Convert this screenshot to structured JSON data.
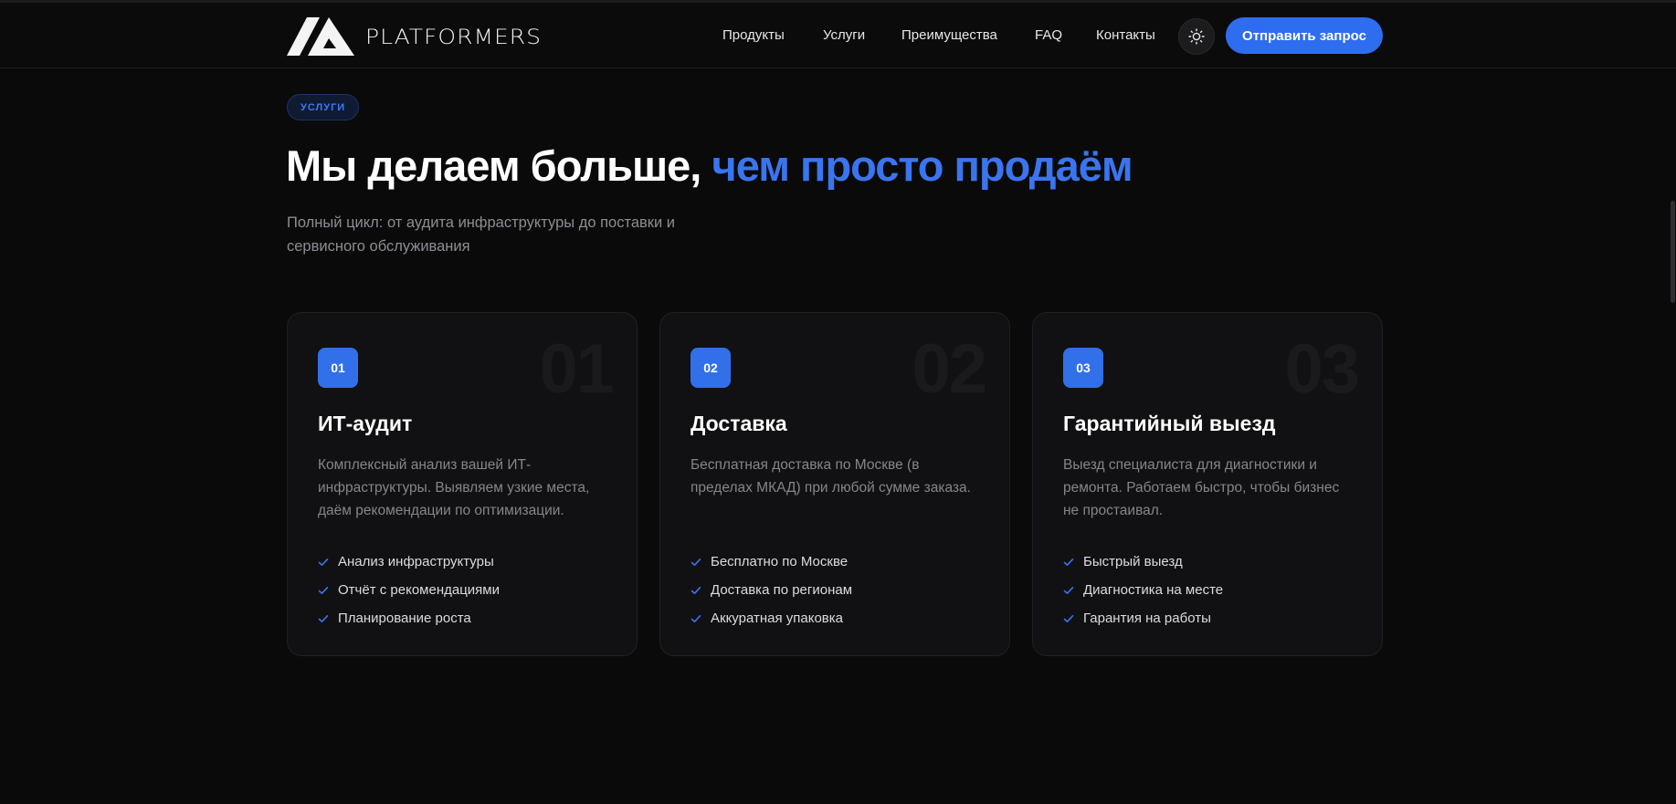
{
  "header": {
    "logo_text": "PLATFORMERS",
    "nav": [
      "Продукты",
      "Услуги",
      "Преимущества",
      "FAQ",
      "Контакты"
    ],
    "theme_toggle_icon": "sun-icon",
    "cta_label": "Отправить запрос"
  },
  "hero": {
    "badge": "УСЛУГИ",
    "title_main": "Мы делаем больше, ",
    "title_accent": "чем просто продаём",
    "subtitle": "Полный цикл: от аудита инфраструктуры до поставки и сервисного обслуживания"
  },
  "cards": [
    {
      "num": "01",
      "title": "ИТ-аудит",
      "desc": "Комплексный анализ вашей ИТ-инфраструктуры. Выявляем узкие места, даём рекомендации по оптимизации.",
      "items": [
        "Анализ инфраструктуры",
        "Отчёт с рекомендациями",
        "Планирование роста"
      ]
    },
    {
      "num": "02",
      "title": "Доставка",
      "desc": "Бесплатная доставка по Москве (в пределах МКАД) при любой сумме заказа.",
      "items": [
        "Бесплатно по Москве",
        "Доставка по регионам",
        "Аккуратная упаковка"
      ]
    },
    {
      "num": "03",
      "title": "Гарантийный выезд",
      "desc": "Выезд специалиста для диагностики и ремонта. Работаем быстро, чтобы бизнес не простаивал.",
      "items": [
        "Быстрый выезд",
        "Диагностика на месте",
        "Гарантия на работы"
      ]
    }
  ],
  "colors": {
    "background": "#0a0a0b",
    "accent": "#3270ea",
    "card_bg": "#111113"
  }
}
